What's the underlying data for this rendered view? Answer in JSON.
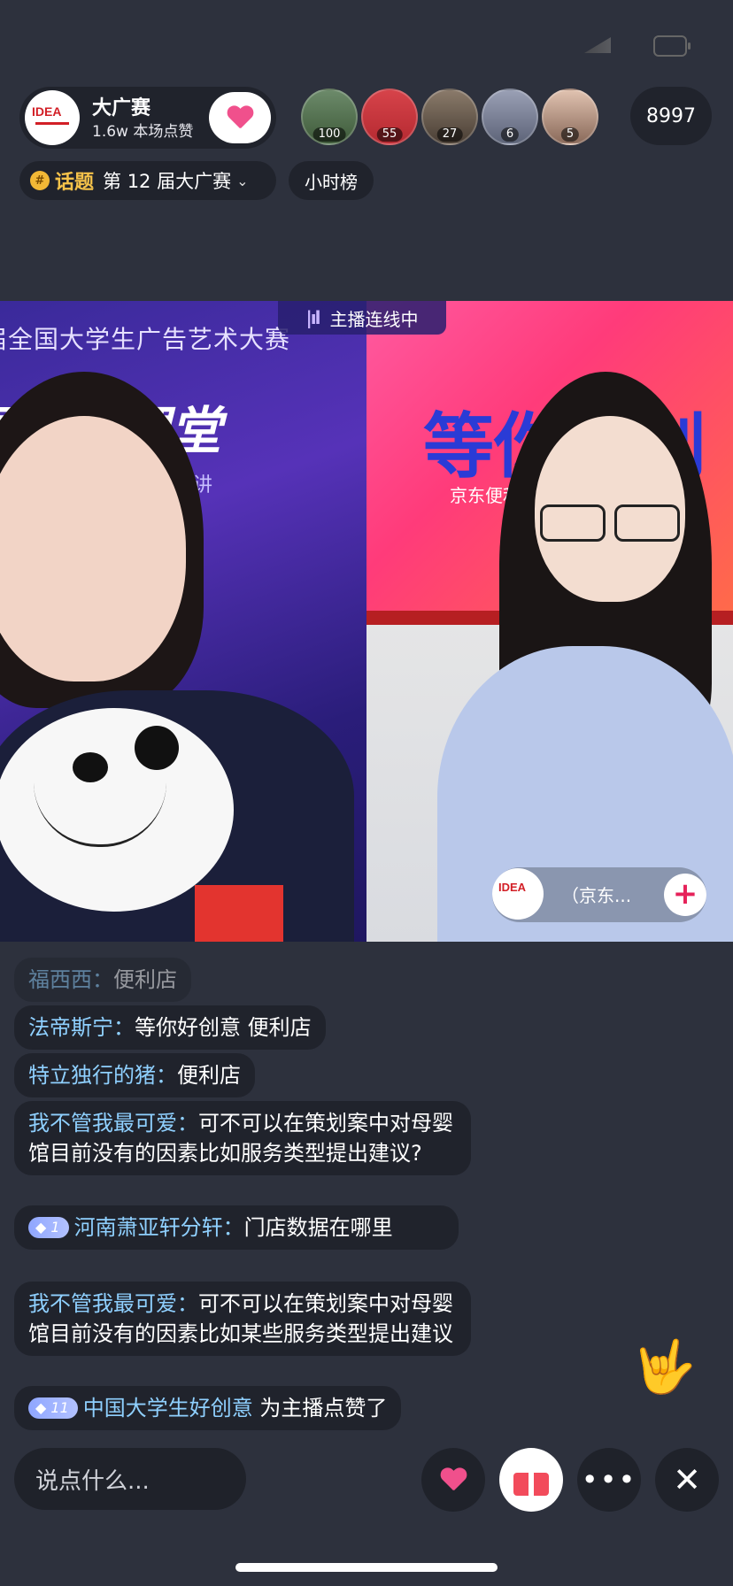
{
  "host": {
    "name": "大广赛",
    "likes": "1.6w 本场点赞"
  },
  "viewers": {
    "avatars": [
      {
        "count": "100"
      },
      {
        "count": "55"
      },
      {
        "count": "27"
      },
      {
        "count": "6"
      },
      {
        "count": "5"
      }
    ],
    "total": "8997"
  },
  "topic": {
    "label": "话题",
    "name": "第 12 届大广赛",
    "hour_rank": "小时榜"
  },
  "video": {
    "link_status": "主播连线中",
    "left_banner_line1": "届全国大学生广告艺术大赛",
    "left_banner_line2": "题解析课堂",
    "left_banner_line3": "巡讲",
    "right_banner_big": "等你好创",
    "right_banner_sub": "京东便利",
    "guest_name": "（京东..."
  },
  "comments": [
    {
      "user": "福西西：",
      "text": "便利店",
      "level": ""
    },
    {
      "user": "法帝斯宁：",
      "text": "等你好创意 便利店",
      "level": ""
    },
    {
      "user": "特立独行的猪：",
      "text": "便利店",
      "level": ""
    },
    {
      "user": "我不管我最可爱：",
      "text": "可不可以在策划案中对母婴馆目前没有的因素比如服务类型提出建议?",
      "level": ""
    },
    {
      "user": "河南萧亚轩分轩：",
      "text": "门店数据在哪里",
      "level": "1"
    },
    {
      "user": "我不管我最可爱：",
      "text": "可不可以在策划案中对母婴馆目前没有的因素比如某些服务类型提出建议",
      "level": ""
    },
    {
      "user": "中国大学生好创意",
      "text": "为主播点赞了",
      "level": "11"
    }
  ],
  "bottom": {
    "input_placeholder": "说点什么..."
  },
  "colors": {
    "background": "#2d313d",
    "topic_accent": "#f6c34a",
    "username": "#8fd0ff",
    "heart": "#f0508c"
  }
}
